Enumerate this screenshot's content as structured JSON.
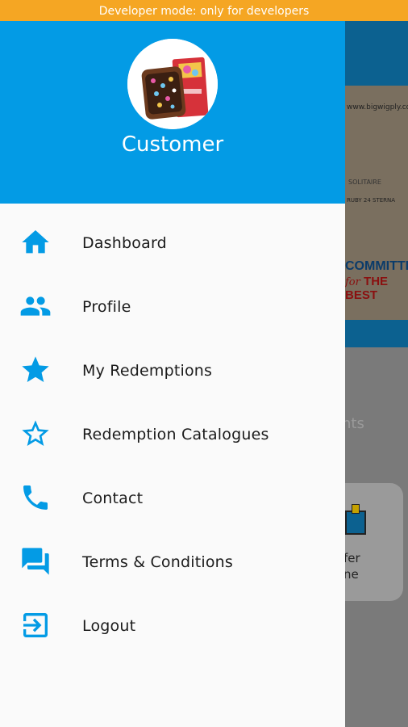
{
  "dev_banner": "Developer mode: only for developers",
  "drawer": {
    "customer_name": "Customer",
    "items": [
      {
        "label": "Dashboard",
        "icon": "home-icon"
      },
      {
        "label": "Profile",
        "icon": "people-icon"
      },
      {
        "label": "My Redemptions",
        "icon": "star-icon"
      },
      {
        "label": "Redemption Catalogues",
        "icon": "star-outline-icon"
      },
      {
        "label": "Contact",
        "icon": "phone-icon"
      },
      {
        "label": "Terms & Conditions",
        "icon": "chat-icon"
      },
      {
        "label": "Logout",
        "icon": "logout-icon"
      }
    ]
  },
  "background": {
    "banner_url": "www.bigwigply.co",
    "banner_logo": "SOLITAIRE",
    "banner_strip": "RUBY 24 STERNA",
    "banner_committed": "COMMITTED",
    "banner_for": "for",
    "banner_best": "THE BEST",
    "section_title_partial": "nts",
    "card_line1": "fer",
    "card_line2": "ne"
  },
  "colors": {
    "primary": "#039be5",
    "icon": "#039be5",
    "dev_banner": "#f5a623"
  }
}
